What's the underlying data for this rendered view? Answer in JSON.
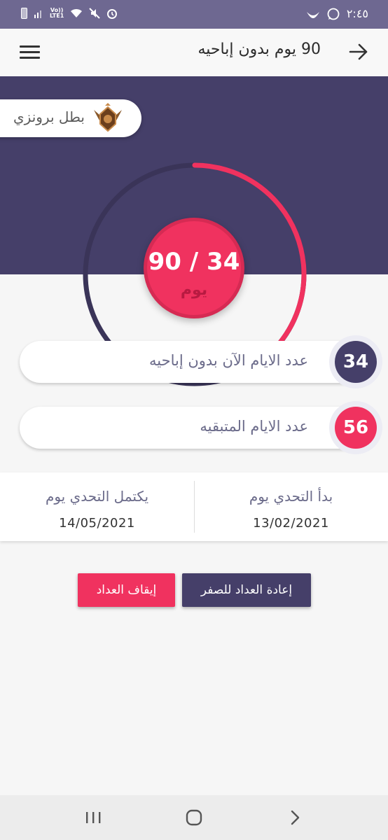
{
  "status_bar": {
    "time": "٢:٤٥",
    "lte_label_top": "Vo))",
    "lte_label_bottom": "LTE1",
    "icons": [
      "battery-icon",
      "signal-icon",
      "lte-icon",
      "wifi-icon",
      "mute-icon",
      "alarm-icon",
      "bird-icon",
      "whatsapp-icon"
    ]
  },
  "app_bar": {
    "title": "90 يوم بدون إباحيه"
  },
  "hero": {
    "badge_label": "بطل برونزي",
    "badge_icon": "bronze-rank-icon",
    "count_text": "90 / 34",
    "unit": "يوم",
    "progress": 0.378
  },
  "stats": [
    {
      "label": "عدد الايام الآن بدون إباحيه",
      "value": "34",
      "color": "#453f69"
    },
    {
      "label": "عدد الايام المتبقيه",
      "value": "56",
      "color": "#f0325f"
    }
  ],
  "dates": {
    "start_title": "بدأ التحدي يوم",
    "start_value": "13/02/2021",
    "end_title": "يكتمل التحدي يوم",
    "end_value": "14/05/2021"
  },
  "buttons": {
    "reset": "إعادة العداد للصفر",
    "stop": "إيقاف العداد"
  },
  "colors": {
    "primary": "#453f69",
    "accent": "#f0325f"
  }
}
